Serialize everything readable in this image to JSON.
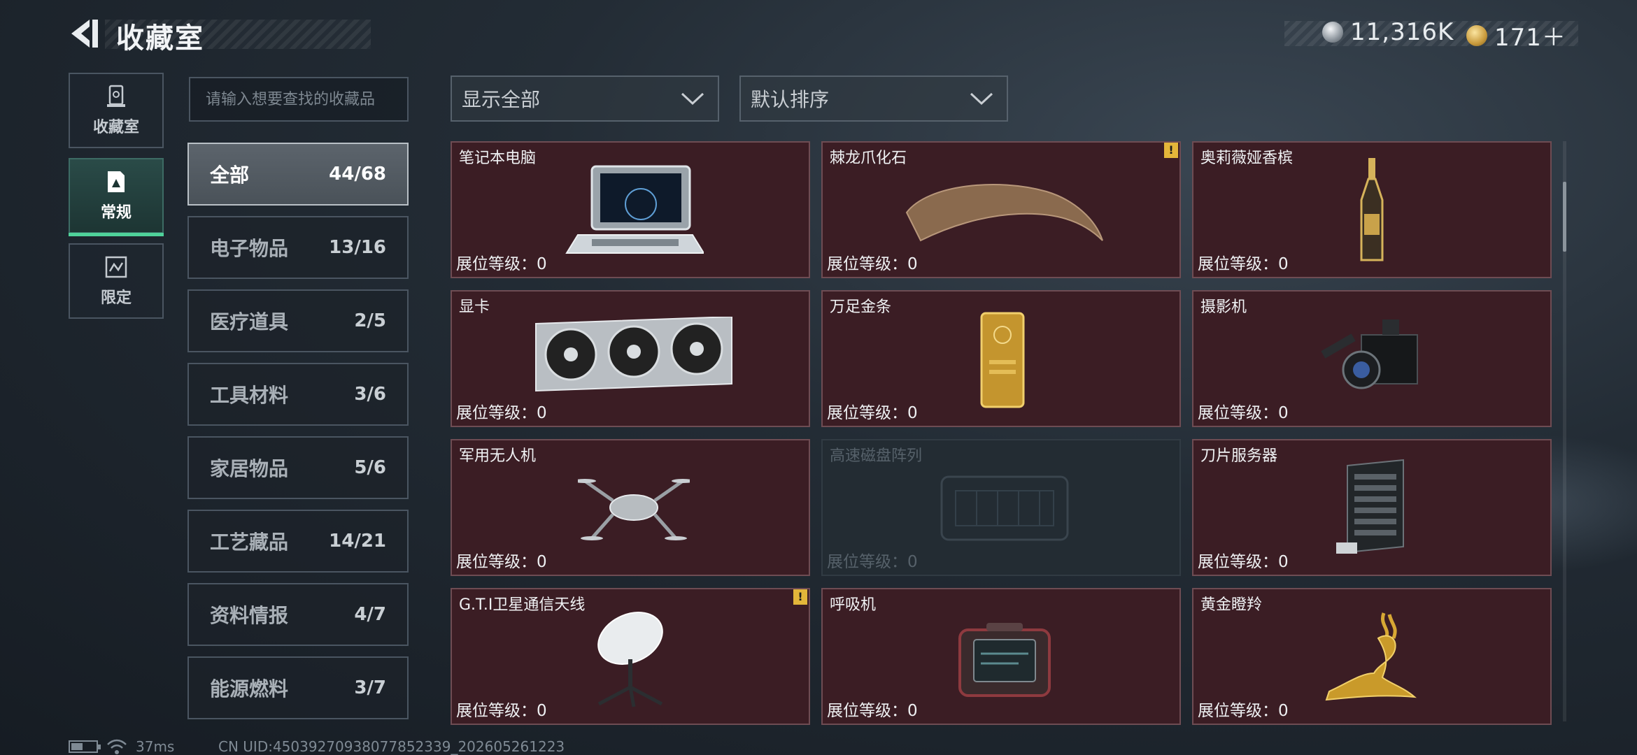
{
  "header": {
    "title": "收藏室",
    "currency_silver": "11,316K",
    "currency_gold": "171＋"
  },
  "nav": [
    {
      "label": "收藏室",
      "icon": "trophy-icon"
    },
    {
      "label": "常规",
      "icon": "document-icon",
      "active": true
    },
    {
      "label": "限定",
      "icon": "shuffle-icon"
    }
  ],
  "search": {
    "placeholder": "请输入想要查找的收藏品",
    "value": ""
  },
  "filters": {
    "show": "显示全部",
    "sort": "默认排序"
  },
  "categories": [
    {
      "name": "全部",
      "count": "44/68",
      "active": true
    },
    {
      "name": "电子物品",
      "count": "13/16"
    },
    {
      "name": "医疗道具",
      "count": "2/5"
    },
    {
      "name": "工具材料",
      "count": "3/6"
    },
    {
      "name": "家居物品",
      "count": "5/6"
    },
    {
      "name": "工艺藏品",
      "count": "14/21"
    },
    {
      "name": "资料情报",
      "count": "4/7"
    },
    {
      "name": "能源燃料",
      "count": "3/7"
    }
  ],
  "items": [
    {
      "name": "笔记本电脑",
      "level": "展位等级：0",
      "icon": "laptop-icon"
    },
    {
      "name": "棘龙爪化石",
      "level": "展位等级：0",
      "icon": "claw-fossil-icon",
      "warning": "!"
    },
    {
      "name": "奥莉薇娅香槟",
      "level": "展位等级：0",
      "icon": "champagne-bottle-icon"
    },
    {
      "name": "显卡",
      "level": "展位等级：0",
      "icon": "graphics-card-icon"
    },
    {
      "name": "万足金条",
      "level": "展位等级：0",
      "icon": "gold-bar-icon"
    },
    {
      "name": "摄影机",
      "level": "展位等级：0",
      "icon": "video-camera-icon"
    },
    {
      "name": "军用无人机",
      "level": "展位等级：0",
      "icon": "drone-icon"
    },
    {
      "name": "高速磁盘阵列",
      "level": "展位等级：0",
      "icon": "disk-array-icon",
      "locked": true
    },
    {
      "name": "刀片服务器",
      "level": "展位等级：0",
      "icon": "server-rack-icon"
    },
    {
      "name": "G.T.I卫星通信天线",
      "level": "展位等级：0",
      "icon": "satellite-dish-icon",
      "warning": "!"
    },
    {
      "name": "呼吸机",
      "level": "展位等级：0",
      "icon": "ventilator-icon"
    },
    {
      "name": "黄金瞪羚",
      "level": "展位等级：0",
      "icon": "golden-gazelle-icon"
    }
  ],
  "status": {
    "ping": "37ms",
    "uid": "CN UID:4503927093807785233​9_202605261223"
  },
  "colors": {
    "card_bg": "#3b1d24",
    "accent_green": "#4fd29a",
    "warning": "#e3b63a"
  }
}
